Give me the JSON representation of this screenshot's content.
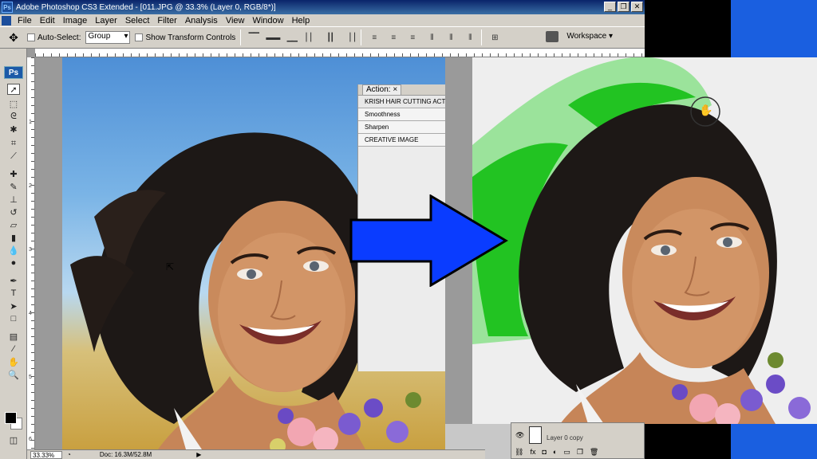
{
  "window": {
    "title": "Adobe Photoshop CS3 Extended - [011.JPG @ 33.3% (Layer 0, RGB/8*)]",
    "minimize": "_",
    "restore": "❐",
    "close": "✕",
    "app_icon": "Ps"
  },
  "menu": [
    "File",
    "Edit",
    "Image",
    "Layer",
    "Select",
    "Filter",
    "Analysis",
    "View",
    "Window",
    "Help"
  ],
  "options_bar": {
    "auto_select_label": "Auto-Select:",
    "auto_select_value": "Group",
    "show_transform_label": "Show Transform Controls",
    "workspace_label": "Workspace ▾"
  },
  "toolbox": {
    "logo": "Ps"
  },
  "actions_panel": {
    "tab_label": "Action: ×",
    "items": [
      "KRISH HAIR CUTTING ACT",
      "Smoothness",
      "Sharpen",
      "CREATIVE IMAGE"
    ]
  },
  "status_bar": {
    "zoom": "33.33%",
    "doc_size": "Doc: 16.3M/52.8M"
  },
  "layers_panel": {
    "layer_name": "Layer 0 copy"
  },
  "ruler": {
    "left_numbers": [
      "1",
      "2",
      "3",
      "4",
      "5",
      "6"
    ]
  },
  "colors": {
    "arrow": "#0a3cff",
    "hair_mask": "#22c322",
    "hair_mask_light": "#9be39b",
    "accent_blue": "#1a5fe0"
  },
  "icons": {
    "move_tool": "move-tool-icon",
    "hand_cursor": "hand-cursor-icon",
    "arrow_cursor": "arrow-cursor-icon"
  }
}
